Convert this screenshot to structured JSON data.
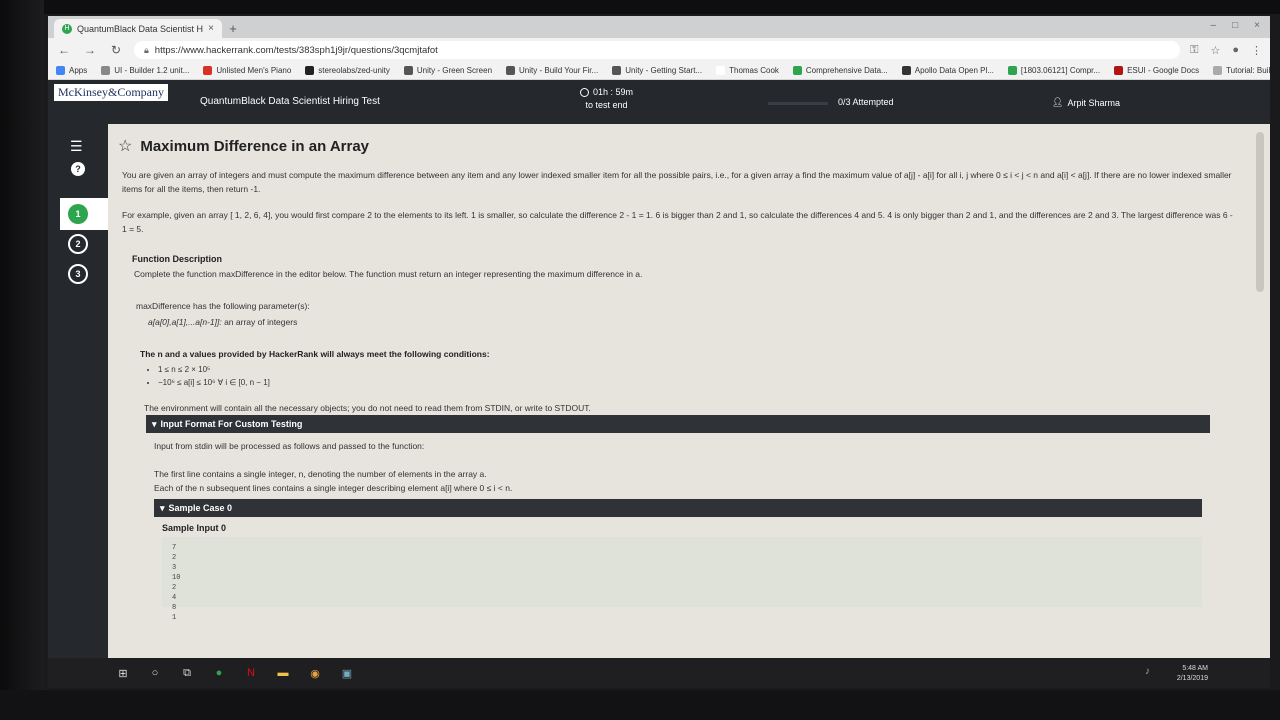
{
  "browser": {
    "tab_title": "QuantumBlack Data Scientist H...",
    "tab_close": "×",
    "new_tab": "+",
    "win_min": "–",
    "win_max": "□",
    "win_close": "×",
    "url": "https://www.hackerrank.com/tests/383sph1j9jr/questions/3qcmjtafot",
    "back": "←",
    "forward": "→",
    "reload": "↻"
  },
  "bookmarks": [
    {
      "label": "Apps",
      "color": "#4285f4"
    },
    {
      "label": "UI - Builder 1.2 unit...",
      "color": "#888888"
    },
    {
      "label": "Unlisted Men's Piano",
      "color": "#d93025"
    },
    {
      "label": "stereolabs/zed-unity",
      "color": "#222222"
    },
    {
      "label": "Unity - Green Screen",
      "color": "#555555"
    },
    {
      "label": "Unity - Build Your Fir...",
      "color": "#555555"
    },
    {
      "label": "Unity - Getting Start...",
      "color": "#555555"
    },
    {
      "label": "Thomas Cook",
      "color": "#ffffff"
    },
    {
      "label": "Comprehensive Data...",
      "color": "#2ea44f"
    },
    {
      "label": "Apollo Data Open Pl...",
      "color": "#333333"
    },
    {
      "label": "[1803.06121] Compr...",
      "color": "#2ea44f"
    },
    {
      "label": "ESUI - Google Docs",
      "color": "#b31412"
    },
    {
      "label": "Tutorial: Build a lane...",
      "color": "#aaaaaa"
    }
  ],
  "header": {
    "brand": "McKinsey&Company",
    "test_title": "QuantumBlack Data Scientist Hiring Test",
    "timer": "01h : 59m",
    "timer_sub": "to test end",
    "attempted": "0/3 Attempted",
    "progress_fraction": 0,
    "user": "Arpit Sharma"
  },
  "rail": {
    "menu": "☰",
    "help": "?",
    "q1": "1",
    "q2": "2",
    "q3": "3"
  },
  "question": {
    "title": "Maximum Difference in an Array",
    "intro": "You are given an array of integers and must compute the maximum difference between any item and any lower indexed smaller item for all the possible pairs, i.e., for a given array a find the maximum value of a[j] - a[i] for all i, j where 0 ≤ i < j < n and a[i] < a[j]. If there are no lower indexed smaller items for all the items, then return -1.",
    "example": "For example, given an array [ 1, 2, 6, 4], you would first compare 2 to the elements to its left. 1 is smaller, so calculate the difference 2 - 1 = 1. 6 is bigger than 2 and 1, so calculate the differences 4 and 5. 4 is only bigger than 2 and 1, and the differences are 2 and 3. The largest difference was 6 - 1 = 5.",
    "func_head": "Function Description",
    "func_text": "Complete the function maxDifference in the editor below. The function must return an integer representing the maximum difference in a.",
    "param_head": "maxDifference has the following parameter(s):",
    "param_name": "a[a[0],a[1],...a[n-1]]:",
    "param_desc": " an array of integers",
    "cond_head": "The n and a values provided by HackerRank will always meet the following conditions:",
    "cond1": "1 ≤ n ≤ 2 × 10⁵",
    "cond2": "−10⁶ ≤ a[i] ≤ 10⁶ ∀ i ∈ [0, n − 1]",
    "env_note": "The environment will contain all the necessary objects; you do not need to read them from STDIN, or write to STDOUT.",
    "input_format_head": "Input Format For Custom Testing",
    "input_format_1": "Input from stdin will be processed as follows and passed to the function:",
    "input_format_2": "The first line contains a single integer, n, denoting the number of elements in the array a.",
    "input_format_3": "Each of the n subsequent lines contains a single integer describing element a[i] where 0 ≤ i < n.",
    "sample_head": "Sample Case 0",
    "sample_input_label": "Sample Input 0",
    "sample_input": [
      "7",
      "2",
      "3",
      "10",
      "2",
      "4",
      "8",
      "1"
    ]
  },
  "taskbar": {
    "time": "5:48 AM",
    "date": "2/13/2019"
  }
}
